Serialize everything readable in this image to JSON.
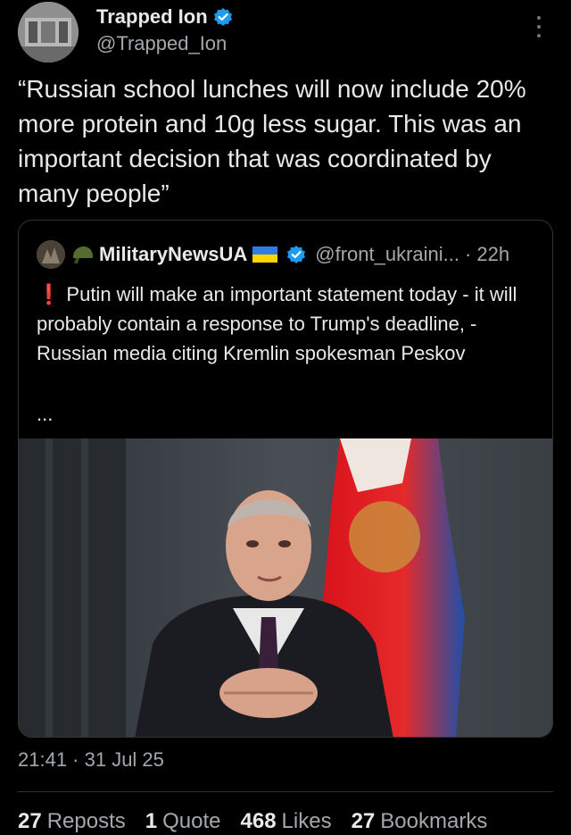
{
  "author": {
    "display_name": "Trapped Ion",
    "handle": "@Trapped_Ion",
    "verified": true
  },
  "tweet": {
    "text": "“Russian school lunches will now include 20% more protein and 10g less sugar. This was an important decision that was coordinated by many people”"
  },
  "quote": {
    "display_name": "MilitaryNewsUA",
    "handle": "@front_ukraini...",
    "separator": "·",
    "time": "22h",
    "text": "Putin will make an important statement today - it will probably contain a response to Trump's deadline, - Russian media citing Kremlin spokesman Peskov",
    "ellipsis": "...",
    "alert_icon": "red-exclamation-icon",
    "helmet_icon": "helmet-icon",
    "flag_icon": "ukraine-flag-icon"
  },
  "meta": {
    "timestamp": "21:41 · 31 Jul 25"
  },
  "stats": [
    {
      "count": "27",
      "label": "Reposts"
    },
    {
      "count": "1",
      "label": "Quote"
    },
    {
      "count": "468",
      "label": "Likes"
    },
    {
      "count": "27",
      "label": "Bookmarks"
    }
  ],
  "colors": {
    "background": "#000000",
    "verified": "#1d9bf0",
    "alert": "#e0245e",
    "secondary_text": "#a3a8ad"
  }
}
